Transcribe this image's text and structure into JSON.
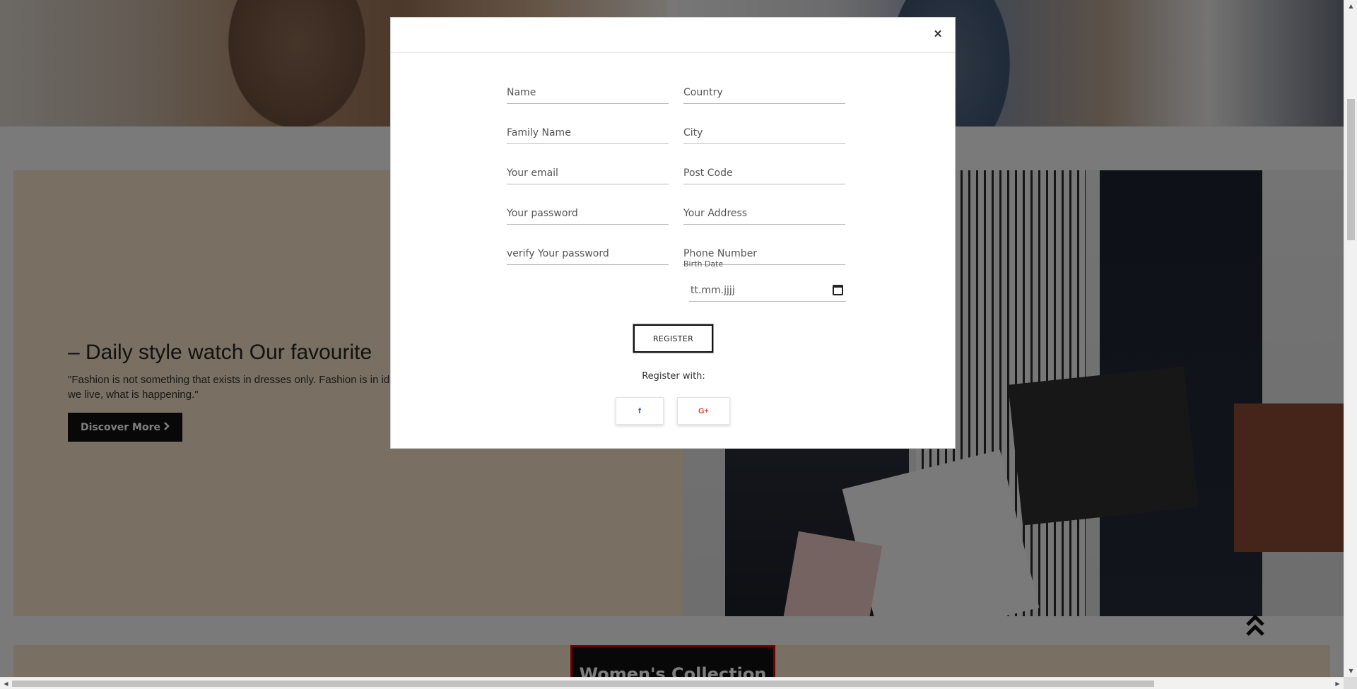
{
  "promo": {
    "heading": "– Daily style watch Our favourite",
    "quote": "\"Fashion is not something that exists in dresses only. Fashion is in ideas, the way we live, what is happening.\"",
    "discover_label": "Discover More",
    "discover_icon": "chevron-right-icon"
  },
  "collection": {
    "title": "Women's Collection"
  },
  "scroll_top_icon": "double-chevron-up-icon",
  "modal": {
    "close_label": "×",
    "fields": {
      "name": "Name",
      "country": "Country",
      "family_name": "Family Name",
      "city": "City",
      "email": "Your email",
      "post_code": "Post Code",
      "password": "Your password",
      "address": "Your Address",
      "verify_password": "verify Your password",
      "phone": "Phone Number"
    },
    "birth_date_label": "Birth Date",
    "birth_date_value": "tt.mm.jjjj",
    "register_label": "REGISTER",
    "register_with": "Register with:",
    "social": {
      "facebook": "f",
      "google": "G+"
    }
  },
  "colors": {
    "promo_bg": "#f3dfc4",
    "accent_red": "#d40000",
    "facebook": "#3b5998",
    "google": "#dd4b39"
  }
}
